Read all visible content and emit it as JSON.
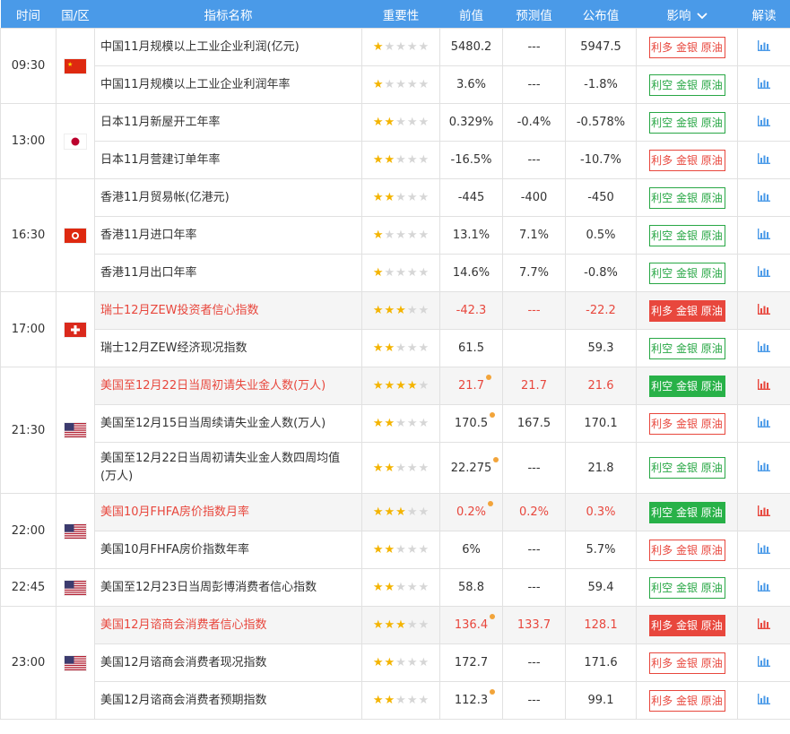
{
  "header": {
    "time": "时间",
    "country": "国/区",
    "indicator": "指标名称",
    "importance": "重要性",
    "previous": "前值",
    "forecast": "预测值",
    "actual": "公布值",
    "impact": "影响",
    "interpret": "解读"
  },
  "groups": [
    {
      "time": "09:30",
      "flag": "cn",
      "rows": [
        {
          "name": "中国11月规模以上工业企业利润(亿元)",
          "stars": 1,
          "prev": "5480.2",
          "fore": "---",
          "act": "5947.5",
          "impact": "利多 金银 原油",
          "style": "red",
          "hl": false,
          "dot": false
        },
        {
          "name": "中国11月规模以上工业企业利润年率",
          "stars": 1,
          "prev": "3.6%",
          "fore": "---",
          "act": "-1.8%",
          "impact": "利空 金银 原油",
          "style": "green",
          "hl": false,
          "dot": false
        }
      ]
    },
    {
      "time": "13:00",
      "flag": "jp",
      "rows": [
        {
          "name": "日本11月新屋开工年率",
          "stars": 2,
          "prev": "0.329%",
          "fore": "-0.4%",
          "act": "-0.578%",
          "impact": "利空 金银 原油",
          "style": "green",
          "hl": false,
          "dot": false
        },
        {
          "name": "日本11月营建订单年率",
          "stars": 2,
          "prev": "-16.5%",
          "fore": "---",
          "act": "-10.7%",
          "impact": "利多 金银 原油",
          "style": "red",
          "hl": false,
          "dot": false
        }
      ]
    },
    {
      "time": "16:30",
      "flag": "hk",
      "rows": [
        {
          "name": "香港11月贸易帐(亿港元)",
          "stars": 2,
          "prev": "-445",
          "fore": "-400",
          "act": "-450",
          "impact": "利空 金银 原油",
          "style": "green",
          "hl": false,
          "dot": false
        },
        {
          "name": "香港11月进口年率",
          "stars": 1,
          "prev": "13.1%",
          "fore": "7.1%",
          "act": "0.5%",
          "impact": "利空 金银 原油",
          "style": "green",
          "hl": false,
          "dot": false
        },
        {
          "name": "香港11月出口年率",
          "stars": 1,
          "prev": "14.6%",
          "fore": "7.7%",
          "act": "-0.8%",
          "impact": "利空 金银 原油",
          "style": "green",
          "hl": false,
          "dot": false
        }
      ]
    },
    {
      "time": "17:00",
      "flag": "ch",
      "rows": [
        {
          "name": "瑞士12月ZEW投资者信心指数",
          "stars": 3,
          "prev": "-42.3",
          "fore": "---",
          "act": "-22.2",
          "impact": "利多 金银 原油",
          "style": "red-fill",
          "hl": true,
          "dot": false
        },
        {
          "name": "瑞士12月ZEW经济现况指数",
          "stars": 2,
          "prev": "61.5",
          "fore": "",
          "act": "59.3",
          "impact": "利空 金银 原油",
          "style": "green",
          "hl": false,
          "dot": false
        }
      ]
    },
    {
      "time": "21:30",
      "flag": "us",
      "rows": [
        {
          "name": "美国至12月22日当周初请失业金人数(万人)",
          "stars": 4,
          "prev": "21.7",
          "fore": "21.7",
          "act": "21.6",
          "impact": "利空 金银 原油",
          "style": "green-fill",
          "hl": true,
          "dot": true
        },
        {
          "name": "美国至12月15日当周续请失业金人数(万人)",
          "stars": 2,
          "prev": "170.5",
          "fore": "167.5",
          "act": "170.1",
          "impact": "利多 金银 原油",
          "style": "red",
          "hl": false,
          "dot": true
        },
        {
          "name": "美国至12月22日当周初请失业金人数四周均值(万人)",
          "stars": 2,
          "prev": "22.275",
          "fore": "---",
          "act": "21.8",
          "impact": "利空 金银 原油",
          "style": "green",
          "hl": false,
          "dot": true
        }
      ]
    },
    {
      "time": "22:00",
      "flag": "us",
      "rows": [
        {
          "name": "美国10月FHFA房价指数月率",
          "stars": 3,
          "prev": "0.2%",
          "fore": "0.2%",
          "act": "0.3%",
          "impact": "利空 金银 原油",
          "style": "green-fill",
          "hl": true,
          "dot": true
        },
        {
          "name": "美国10月FHFA房价指数年率",
          "stars": 2,
          "prev": "6%",
          "fore": "---",
          "act": "5.7%",
          "impact": "利多 金银 原油",
          "style": "red",
          "hl": false,
          "dot": false
        }
      ]
    },
    {
      "time": "22:45",
      "flag": "us",
      "rows": [
        {
          "name": "美国至12月23日当周彭博消费者信心指数",
          "stars": 2,
          "prev": "58.8",
          "fore": "---",
          "act": "59.4",
          "impact": "利空 金银 原油",
          "style": "green",
          "hl": false,
          "dot": false
        }
      ]
    },
    {
      "time": "23:00",
      "flag": "us",
      "rows": [
        {
          "name": "美国12月谘商会消费者信心指数",
          "stars": 3,
          "prev": "136.4",
          "fore": "133.7",
          "act": "128.1",
          "impact": "利多 金银 原油",
          "style": "red-fill",
          "hl": true,
          "dot": true
        },
        {
          "name": "美国12月谘商会消费者现况指数",
          "stars": 2,
          "prev": "172.7",
          "fore": "---",
          "act": "171.6",
          "impact": "利多 金银 原油",
          "style": "red",
          "hl": false,
          "dot": false
        },
        {
          "name": "美国12月谘商会消费者预期指数",
          "stars": 2,
          "prev": "112.3",
          "fore": "---",
          "act": "99.1",
          "impact": "利多 金银 原油",
          "style": "red",
          "hl": false,
          "dot": true
        }
      ]
    }
  ],
  "colors": {
    "header_bg": "#4a9ae8",
    "bullish_red": "#e8473d",
    "bearish_green": "#28a745",
    "star": "#f4b400",
    "icon_blue": "#4a9ae8"
  }
}
